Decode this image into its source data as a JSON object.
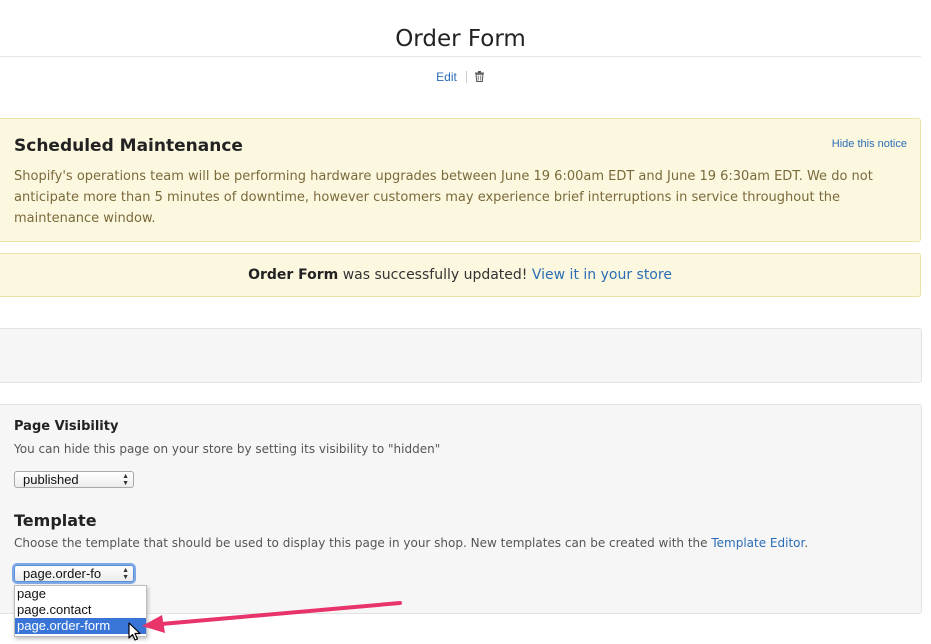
{
  "page": {
    "title": "Order Form",
    "edit_label": "Edit",
    "delete_icon": "trash-icon"
  },
  "maintenance": {
    "title": "Scheduled Maintenance",
    "hide_label": "Hide this notice",
    "body": "Shopify's operations team will be performing hardware upgrades between June 19 6:00am EDT and June 19 6:30am EDT. We do not anticipate more than 5 minutes of downtime, however customers may experience brief interruptions in service throughout the maintenance window."
  },
  "success": {
    "name": "Order Form",
    "message": " was successfully updated! ",
    "link": "View it in your store"
  },
  "visibility": {
    "title": "Page Visibility",
    "description": "You can hide this page on your store by setting its visibility to \"hidden\"",
    "selected": "published"
  },
  "template": {
    "title": "Template",
    "description": "Choose the template that should be used to display this page in your shop. New templates can be created with the ",
    "editor_link": "Template Editor",
    "description_end": ".",
    "selected": "page.order-fo",
    "options": [
      "page",
      "page.contact",
      "page.order-form"
    ],
    "highlighted_option": "page.order-form"
  },
  "colors": {
    "link": "#2b6db5",
    "notice_bg": "#fcf8e0",
    "annotation_arrow": "#e8336b",
    "selection": "#3875d7"
  }
}
